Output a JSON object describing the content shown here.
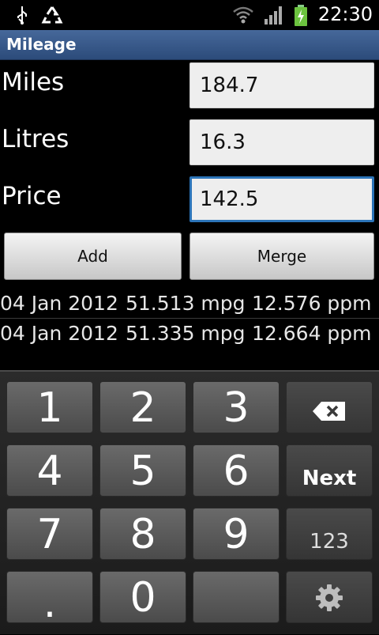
{
  "status_bar": {
    "time": "22:30",
    "icons": [
      "usb-icon",
      "recycle-icon",
      "wifi-icon",
      "signal-icon",
      "battery-charging-icon"
    ]
  },
  "app": {
    "title": "Mileage"
  },
  "form": {
    "miles_label": "Miles",
    "miles_value": "184.7",
    "litres_label": "Litres",
    "litres_value": "16.3",
    "price_label": "Price",
    "price_value": "142.5"
  },
  "buttons": {
    "add": "Add",
    "merge": "Merge"
  },
  "entries": [
    {
      "date": "04 Jan 2012",
      "mpg": "51.513 mpg",
      "ppm": "12.576 ppm"
    },
    {
      "date": "04 Jan 2012",
      "mpg": "51.335 mpg",
      "ppm": "12.664 ppm"
    }
  ],
  "keyboard": {
    "k1": "1",
    "k2": "2",
    "k3": "3",
    "k4": "4",
    "k5": "5",
    "k6": "6",
    "k7": "7",
    "k8": "8",
    "k9": "9",
    "k0": "0",
    "dot": ".",
    "next": "Next",
    "mode": "123"
  },
  "colors": {
    "title_bar": "#2c4b7a",
    "focus_border": "#2c74b8"
  }
}
